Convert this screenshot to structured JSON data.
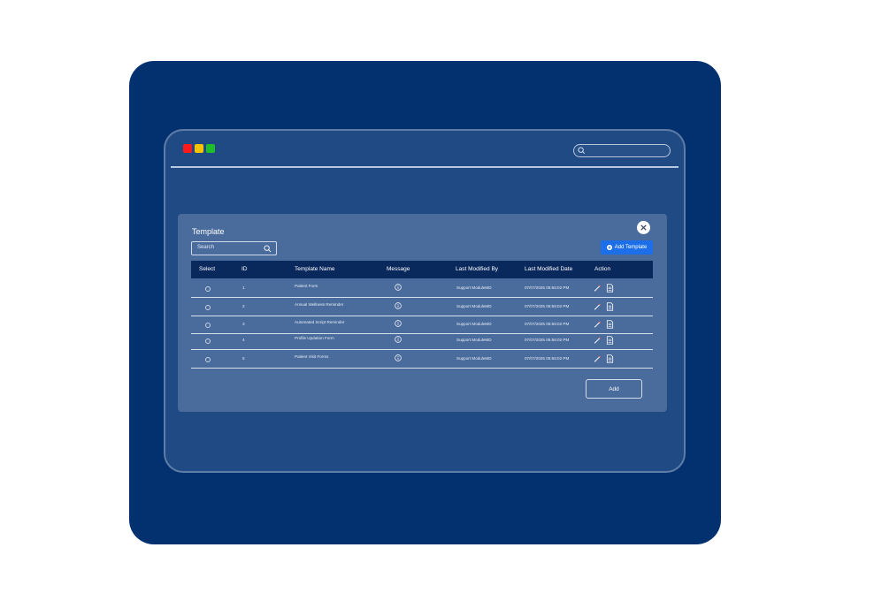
{
  "window": {
    "traffic_lights": [
      {
        "name": "close",
        "color": "#ff1a1a"
      },
      {
        "name": "minimize",
        "color": "#f5c400"
      },
      {
        "name": "maximize",
        "color": "#1fbf2a"
      }
    ],
    "search_placeholder": ""
  },
  "panel": {
    "title": "Template",
    "search_placeholder": "Search",
    "add_template_label": "Add Template",
    "add_button_label": "Add",
    "columns": [
      "Select",
      "ID",
      "Template Name",
      "Message",
      "Last Modified By",
      "Last Modified Date",
      "Action"
    ],
    "rows": [
      {
        "id": "1",
        "name": "Patient Form",
        "modified_by": "Support ModuleMD",
        "modified_date": "07/07/2025 05:56:02 PM"
      },
      {
        "id": "2",
        "name": "Annual Wellness Reminder",
        "modified_by": "Support ModuleMD",
        "modified_date": "07/07/2025 05:56:02 PM"
      },
      {
        "id": "3",
        "name": "Automated Script Reminder",
        "modified_by": "Support ModuleMD",
        "modified_date": "07/07/2025 05:56:02 PM"
      },
      {
        "id": "4",
        "name": "Profile Updation Form",
        "modified_by": "Support ModuleMD",
        "modified_date": "07/07/2025 05:56:02 PM"
      },
      {
        "id": "5",
        "name": "Patient Visit Forms",
        "modified_by": "Support ModuleMD",
        "modified_date": "07/07/2025 05:56:02 PM"
      }
    ]
  },
  "icons": {
    "search": "search-icon",
    "close": "close-icon",
    "plus": "plus-circle-icon",
    "info": "info-icon",
    "edit": "pencil-icon",
    "document": "document-icon"
  },
  "colors": {
    "background_frame": "#03316f",
    "window": "#1f4a84",
    "panel": "#4a6c9c",
    "table_header": "#09285c",
    "primary_button": "#1c6fe8"
  }
}
